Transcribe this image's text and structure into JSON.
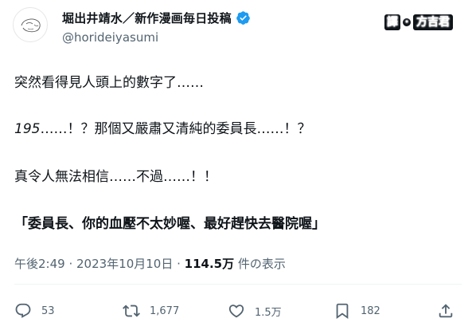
{
  "user": {
    "display_name": "堀出井靖水／新作漫画毎日投稿",
    "handle": "@horideiyasumi"
  },
  "translator": {
    "label_a": "譯",
    "label_b": "方吉君"
  },
  "tweet": {
    "line1": "突然看得見人頭上的數字了……",
    "line2_num": "195",
    "line2_rest": "……！？那個又嚴肅又清純的委員長……！？",
    "line3": "真令人無法相信……不過……！！",
    "line4": "「委員長、你的血壓不太妙喔、最好趕快去醫院喔」"
  },
  "meta": {
    "time": "午後2:49",
    "sep1": " · ",
    "date": "2023年10月10日",
    "sep2": " · ",
    "views": "114.5万",
    "views_label": " 件の表示"
  },
  "actions": {
    "replies": "53",
    "retweets": "1,677",
    "likes": "1.5万",
    "bookmarks": "182"
  },
  "colors": {
    "text": "#0f1419",
    "secondary": "#536471",
    "verified": "#1d9bf0"
  }
}
